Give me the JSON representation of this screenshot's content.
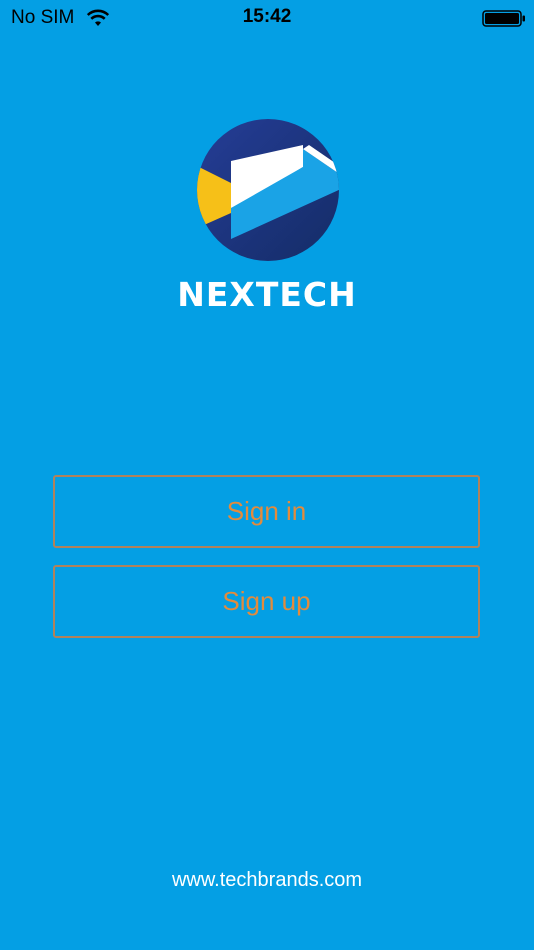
{
  "status_bar": {
    "carrier": "No SIM",
    "time": "15:42",
    "wifi_icon": "wifi-icon",
    "battery_icon": "battery-full-icon"
  },
  "logo": {
    "brand": "NEXTECH",
    "icon": "nextech-logo-icon",
    "colors": {
      "circle": "#1d3a8a",
      "accent_yellow": "#f6c018",
      "accent_blue": "#1aa3e6",
      "white": "#ffffff"
    }
  },
  "actions": {
    "sign_in_label": "Sign in",
    "sign_up_label": "Sign up"
  },
  "footer": {
    "website": "www.techbrands.com"
  },
  "theme": {
    "background": "#049fe4",
    "button_border": "#b2825a",
    "button_text": "#e38b3c"
  }
}
